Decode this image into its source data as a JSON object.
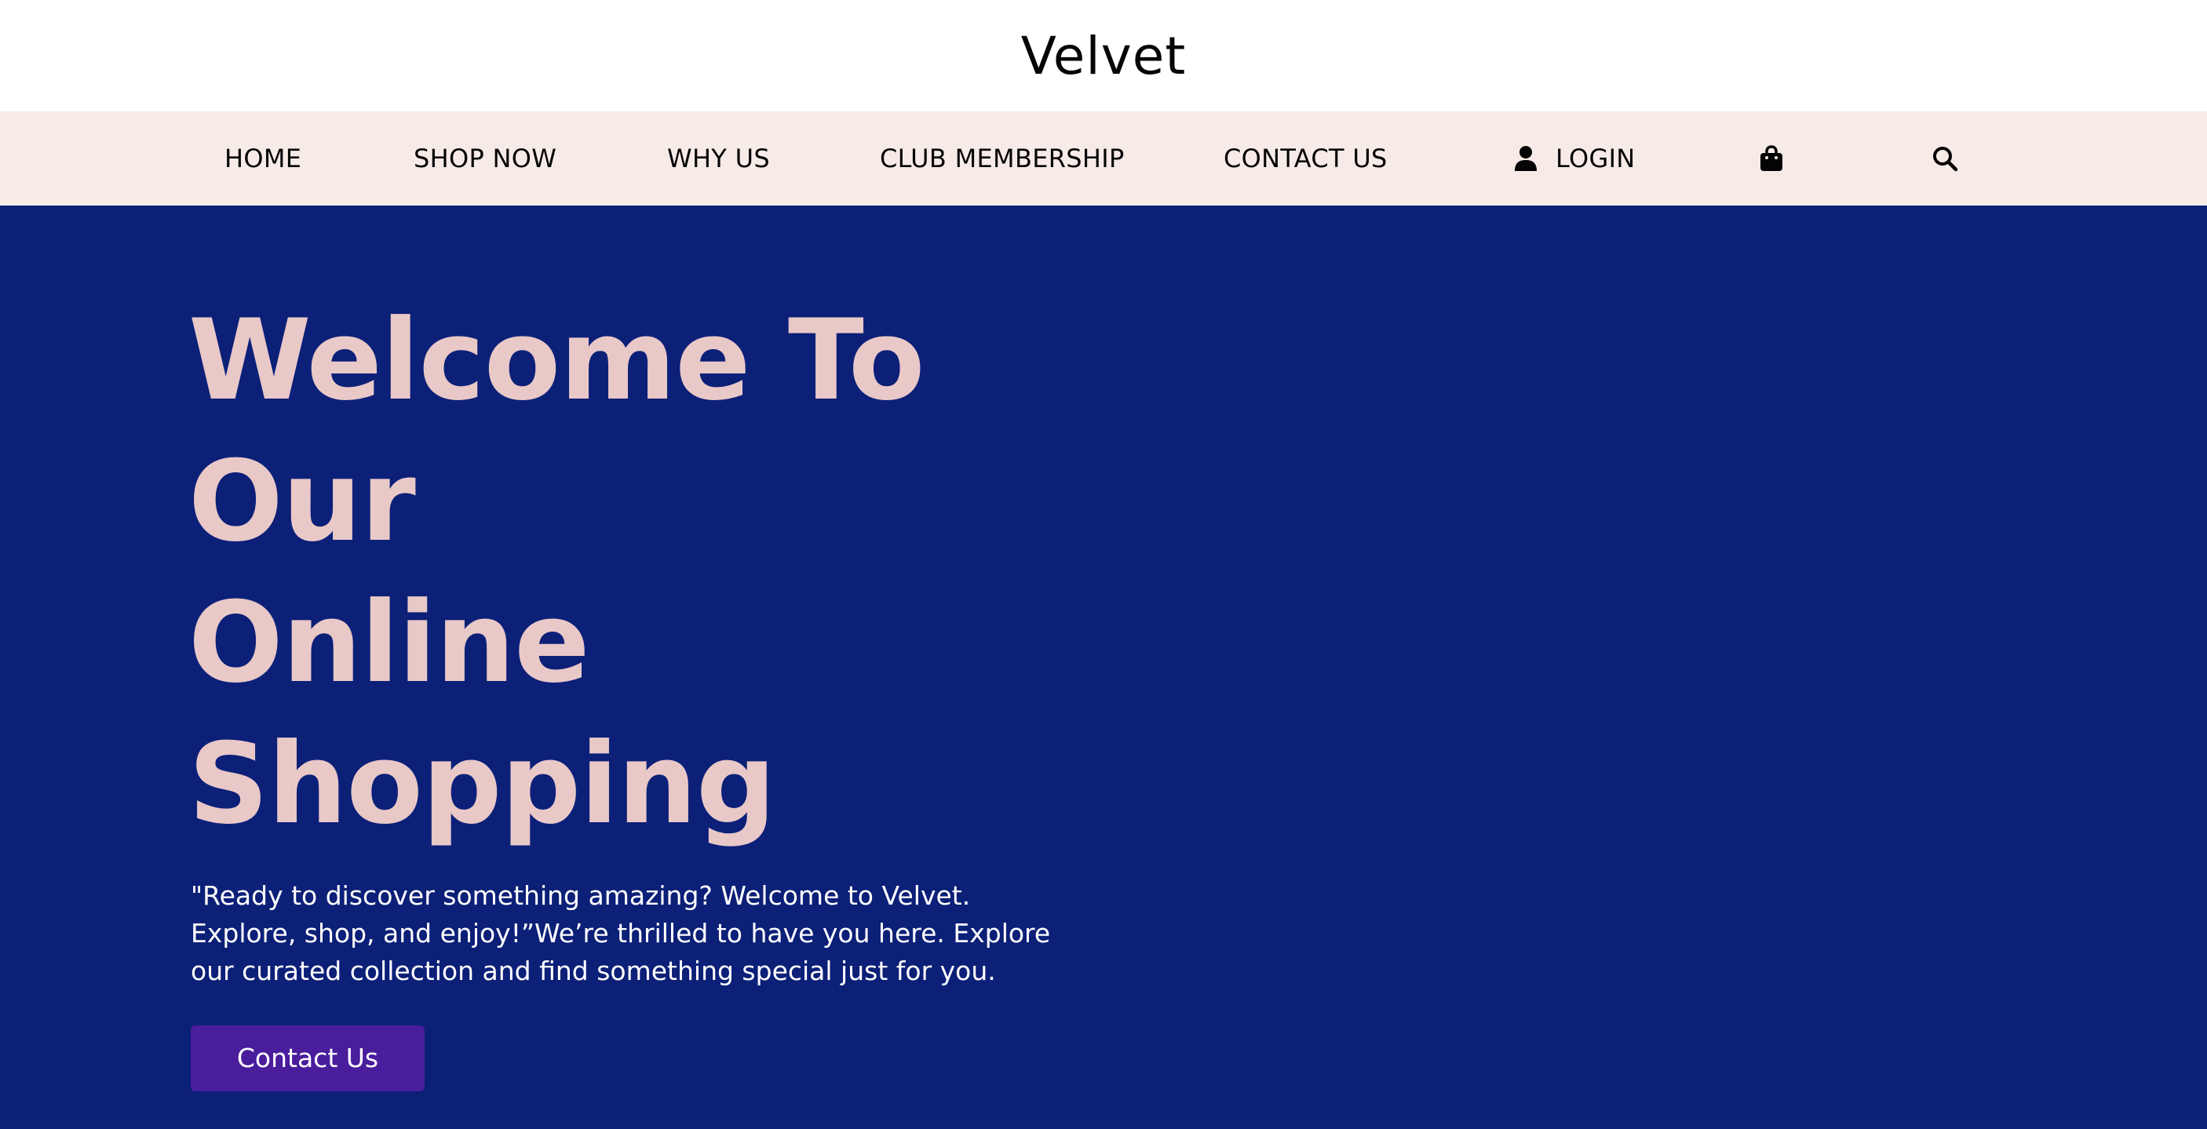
{
  "brand": {
    "title": "Velvet"
  },
  "nav": {
    "home": "HOME",
    "shop_now": "SHOP NOW",
    "why_us": "WHY US",
    "club_membership": "CLUB MEMBERSHIP",
    "contact_us": "CONTACT US",
    "login": "LOGIN",
    "icons": {
      "login": "user-icon",
      "cart": "shopping-bag-icon",
      "search": "search-icon"
    }
  },
  "hero": {
    "title_lines": [
      "Welcome To",
      "Our",
      "Online",
      "Shopping"
    ],
    "description": "\"Ready to discover something amazing? Welcome to Velvet. Explore, shop, and enjoy!”We’re thrilled to have you here. Explore our curated collection and find something special just for you.",
    "cta_label": "Contact Us"
  },
  "colors": {
    "hero_background": "#0c2078",
    "hero_title": "#e9c8c8",
    "nav_background": "#f7ebe7",
    "cta_background": "#4a1d9d"
  }
}
